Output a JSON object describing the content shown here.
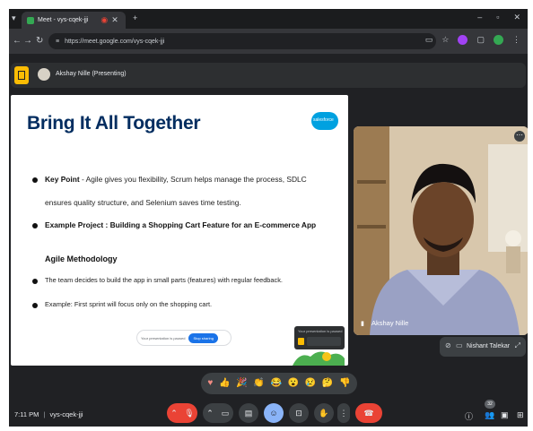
{
  "browser": {
    "tab_title": "Meet - vys-cqek-jji",
    "url": "https://meet.google.com/vys-cqek-jji"
  },
  "presenting": {
    "label": "Akshay Nille (Presenting)"
  },
  "slide": {
    "title": "Bring It All Together",
    "logo_text": "salesforce",
    "key_point_label": "Key Point",
    "key_point_text": " - Agile gives you flexibility, Scrum helps manage the process, SDLC",
    "key_point_text_2": "ensures quality structure, and Selenium saves time testing.",
    "example_label": "Example Project",
    "example_text": " : Building a Shopping Cart Feature for an E-commerce App",
    "subheading": "Agile Methodology",
    "bullet_1": "The team decides to build the app in small parts (features) with regular feedback.",
    "bullet_2": "Example: First sprint will focus only on the shopping cart.",
    "pause_text": "Your presentation is paused",
    "stop_label": "Stop sharing"
  },
  "participants": [
    {
      "name": "Akshay Nille"
    },
    {
      "name": "Nishant Talekar"
    }
  ],
  "reactions": [
    "♥",
    "👍",
    "🎉",
    "👏",
    "😂",
    "😮",
    "😢",
    "🤔",
    "👎"
  ],
  "bottom_bar": {
    "time": "7:11 PM",
    "separator": "|",
    "meeting_code": "vys-cqek-jji",
    "participant_count": "32"
  },
  "colors": {
    "slide_title": "#032d60",
    "salesforce_blue": "#00a1e0",
    "end_call": "#ea4335",
    "present_yellow": "#fbbc04",
    "active_blue": "#8ab4f8"
  },
  "icons": [
    "back-arrow-icon",
    "forward-arrow-icon",
    "reload-icon",
    "site-info-icon",
    "star-icon",
    "extensions-icon",
    "profile-icon",
    "present-icon",
    "more-icon",
    "mic-off-icon",
    "camera-icon",
    "captions-icon",
    "emoji-icon",
    "raise-hand-icon",
    "leave-call-icon",
    "info-icon",
    "people-icon",
    "chat-icon",
    "activities-icon"
  ]
}
